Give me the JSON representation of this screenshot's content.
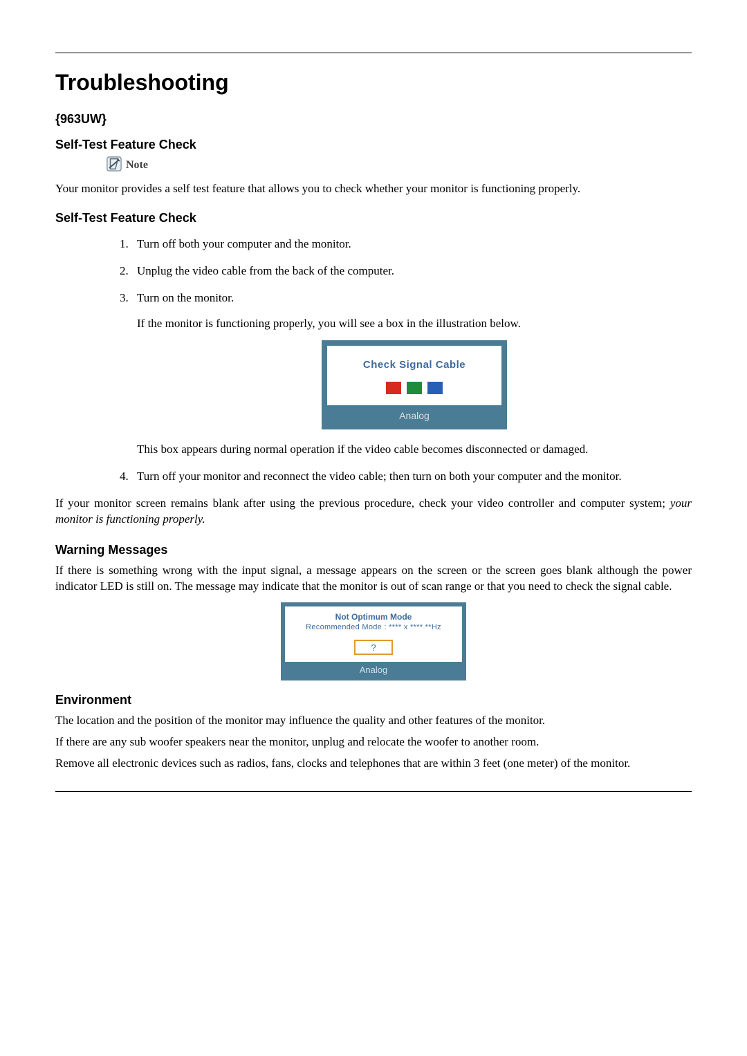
{
  "title": "Troubleshooting",
  "model": "{963UW}",
  "section_selftest": "Self-Test Feature Check",
  "note_label": "Note",
  "note_body": "Your monitor provides a self test feature that allows you to check whether your monitor is functioning properly.",
  "section_selftest2": "Self-Test Feature Check",
  "steps": {
    "s1": "Turn off both your computer and the monitor.",
    "s2": "Unplug the video cable from the back of the computer.",
    "s3": "Turn on the monitor.",
    "s3_after": "If the monitor is functioning properly, you will see a box in the illustration below.",
    "s3_after2": "This box appears during normal operation if the video cable becomes disconnected or damaged.",
    "s4": "Turn off your monitor and reconnect the video cable; then turn on both your computer and the monitor."
  },
  "after_steps_pre": "If your monitor screen remains blank after using the previous procedure, check your video controller and computer system; ",
  "after_steps_em": "your monitor is functioning properly.",
  "fig1": {
    "title": "Check Signal Cable",
    "footer": "Analog",
    "colors": {
      "r": "#d82a1f",
      "g": "#1e8c3a",
      "b": "#265fb5"
    }
  },
  "section_warning": "Warning Messages",
  "warning_body": "If there is something wrong with the input signal, a message appears on the screen or the screen goes blank although the power indicator LED is still on. The message may indicate that the monitor is out of scan range or that you need to check the signal cable.",
  "fig2": {
    "line1": "Not Optimum Mode",
    "line2": "Recommended Mode : **** x ****  **Hz",
    "q": "?",
    "footer": "Analog"
  },
  "section_env": "Environment",
  "env_p1": "The location and the position of the monitor may influence the quality and other features of the monitor.",
  "env_p2": "If there are any sub woofer speakers near the monitor, unplug and relocate the woofer to another room.",
  "env_p3": "Remove all electronic devices such as radios, fans, clocks and telephones that are within 3 feet (one meter) of the monitor."
}
